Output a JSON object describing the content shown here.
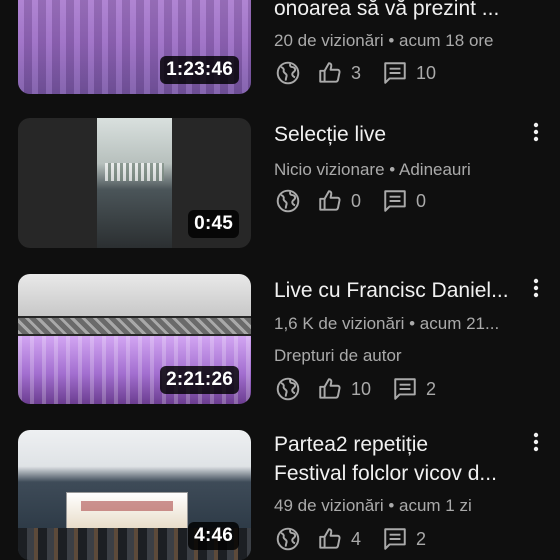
{
  "videos": [
    {
      "title": "onoarea să vă prezint ...",
      "meta1": "20 de vizionări • acum 18 ore",
      "duration": "1:23:46",
      "likes": "3",
      "comments": "10"
    },
    {
      "title": "Selecție live",
      "meta1": "Nicio vizionare • Adineauri",
      "duration": "0:45",
      "likes": "0",
      "comments": "0"
    },
    {
      "title": "Live cu Francisc Daniel...",
      "meta1": "1,6 K de vizionări • acum 21...",
      "meta2": "Drepturi de autor",
      "duration": "2:21:26",
      "likes": "10",
      "comments": "2"
    },
    {
      "title_line1": "Partea2 repetiție",
      "title_line2": "Festival folclor vicov d...",
      "meta1": "49 de vizionări • acum 1 zi",
      "duration": "4:46",
      "likes": "4",
      "comments": "2"
    }
  ],
  "icons": {
    "visibility": "globe-icon",
    "likes": "thumbs-up-icon",
    "comments": "comment-icon",
    "menu": "more-vert-icon"
  },
  "colors": {
    "background": "#0f0f0f",
    "primary_text": "#f1f1f1",
    "secondary_text": "#aaaaaa"
  }
}
